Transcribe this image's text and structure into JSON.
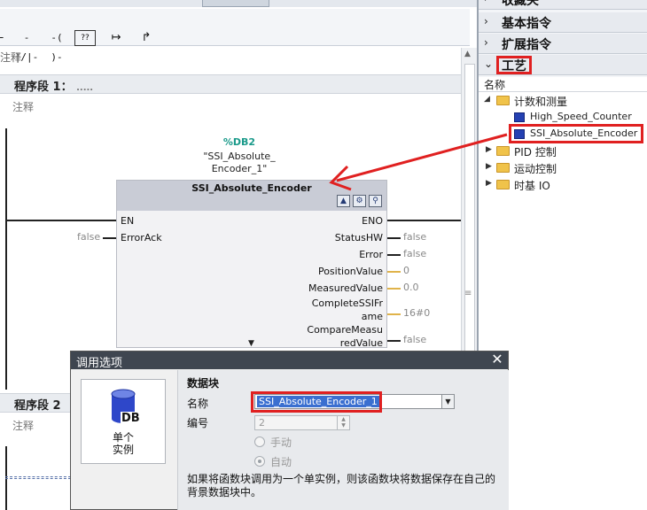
{
  "editor": {
    "favorites_tab": "收藏夹",
    "toolbar": {
      "contact_no": "-|/|-",
      "coil": "-( )-",
      "empty_box": "??",
      "open_branch": "↦",
      "close_branch": "↱"
    },
    "comment_top": "注释",
    "segment1": {
      "title": "程序段 1：",
      "dots": ".....",
      "comment": "注释"
    },
    "segment2": {
      "title": "程序段 2",
      "comment": "注释"
    },
    "fb": {
      "db_number": "%DB2",
      "instance_name": "\"SSI_Absolute_\nEncoder_1\"",
      "block_name": "SSI_Absolute_Encoder",
      "inputs": [
        {
          "name": "EN",
          "value": ""
        },
        {
          "name": "ErrorAck",
          "value": "false"
        }
      ],
      "outputs": [
        {
          "name": "ENO",
          "value": ""
        },
        {
          "name": "StatusHW",
          "value": "false"
        },
        {
          "name": "Error",
          "value": "false"
        },
        {
          "name": "PositionValue",
          "value": "0"
        },
        {
          "name": "MeasuredValue",
          "value": "0.0"
        },
        {
          "name": "CompleteSSIFrame",
          "label": "CompleteSSIFr\name",
          "value": "16#0"
        },
        {
          "name": "CompareMeasuredValue",
          "label": "CompareMeasu\nredValue",
          "value": "false"
        }
      ],
      "icons": [
        "block-icon-1",
        "block-icon-2",
        "block-icon-3"
      ]
    }
  },
  "panel": {
    "categories": [
      {
        "label": "收藏夹",
        "arrow": "›"
      },
      {
        "label": "基本指令",
        "arrow": "›"
      },
      {
        "label": "扩展指令",
        "arrow": "›"
      },
      {
        "label": "工艺",
        "arrow": "⌄"
      }
    ],
    "column_header": "名称",
    "tree": {
      "counting_folder": "计数和测量",
      "items": [
        "High_Speed_Counter",
        "SSI_Absolute_Encoder"
      ],
      "pid_folder": "PID 控制",
      "motion_folder": "运动控制",
      "time_io_folder": "时基 IO"
    }
  },
  "dialog": {
    "title": "调用选项",
    "close": "✕",
    "card_label": "单个\n实例",
    "db_icon_label": "DB",
    "section_title": "数据块",
    "name_label": "名称",
    "name_value": "SSI_Absolute_Encoder_1",
    "number_label": "编号",
    "number_value": "2",
    "manual_label": "手动",
    "auto_label": "自动",
    "description": "如果将函数块调用为一个单实例，则该函数块将数据保存在自己的背景数据块中。"
  },
  "colors": {
    "highlight_red": "#e02020",
    "db_number_teal": "#1a9a8a",
    "dialog_title_bg": "#3f4650",
    "selection_blue": "#3a6fd0",
    "folder_yellow": "#f0c34a"
  }
}
